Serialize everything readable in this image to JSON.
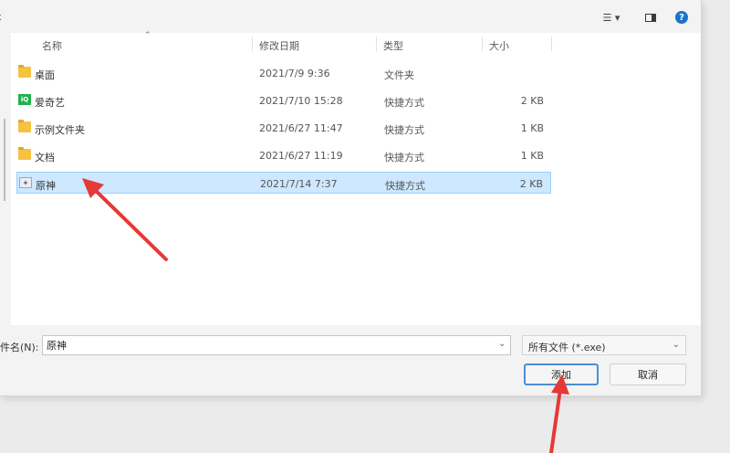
{
  "toolbar": {
    "left_char": "ε",
    "view_icon": "view-list-icon",
    "pane_icon": "preview-pane-icon",
    "help_icon": "help-icon",
    "help_glyph": "?"
  },
  "columns": {
    "name": "名称",
    "date": "修改日期",
    "type": "类型",
    "size": "大小"
  },
  "files": [
    {
      "name": "桌面",
      "date": "2021/7/9 9:36",
      "type": "文件夹",
      "size": "",
      "icon": "folder-icon"
    },
    {
      "name": "爱奇艺",
      "date": "2021/7/10 15:28",
      "type": "快捷方式",
      "size": "2 KB",
      "icon": "iqiyi-app-icon"
    },
    {
      "name": "示例文件夹",
      "date": "2021/6/27 11:47",
      "type": "快捷方式",
      "size": "1 KB",
      "icon": "folder-shortcut-icon"
    },
    {
      "name": "文档",
      "date": "2021/6/27 11:19",
      "type": "快捷方式",
      "size": "1 KB",
      "icon": "folder-shortcut-icon"
    },
    {
      "name": "原神",
      "date": "2021/7/14 7:37",
      "type": "快捷方式",
      "size": "2 KB",
      "icon": "genshin-app-icon",
      "selected": true
    }
  ],
  "footer": {
    "filename_label": "件名(N):",
    "filename_value": "原神",
    "filetype": "所有文件 (*.exe)",
    "add_label": "添加",
    "cancel_label": "取消"
  },
  "colors": {
    "selection": "#cde8ff",
    "annotation_arrow": "#e53935",
    "primary_border": "#4a8fd4"
  }
}
